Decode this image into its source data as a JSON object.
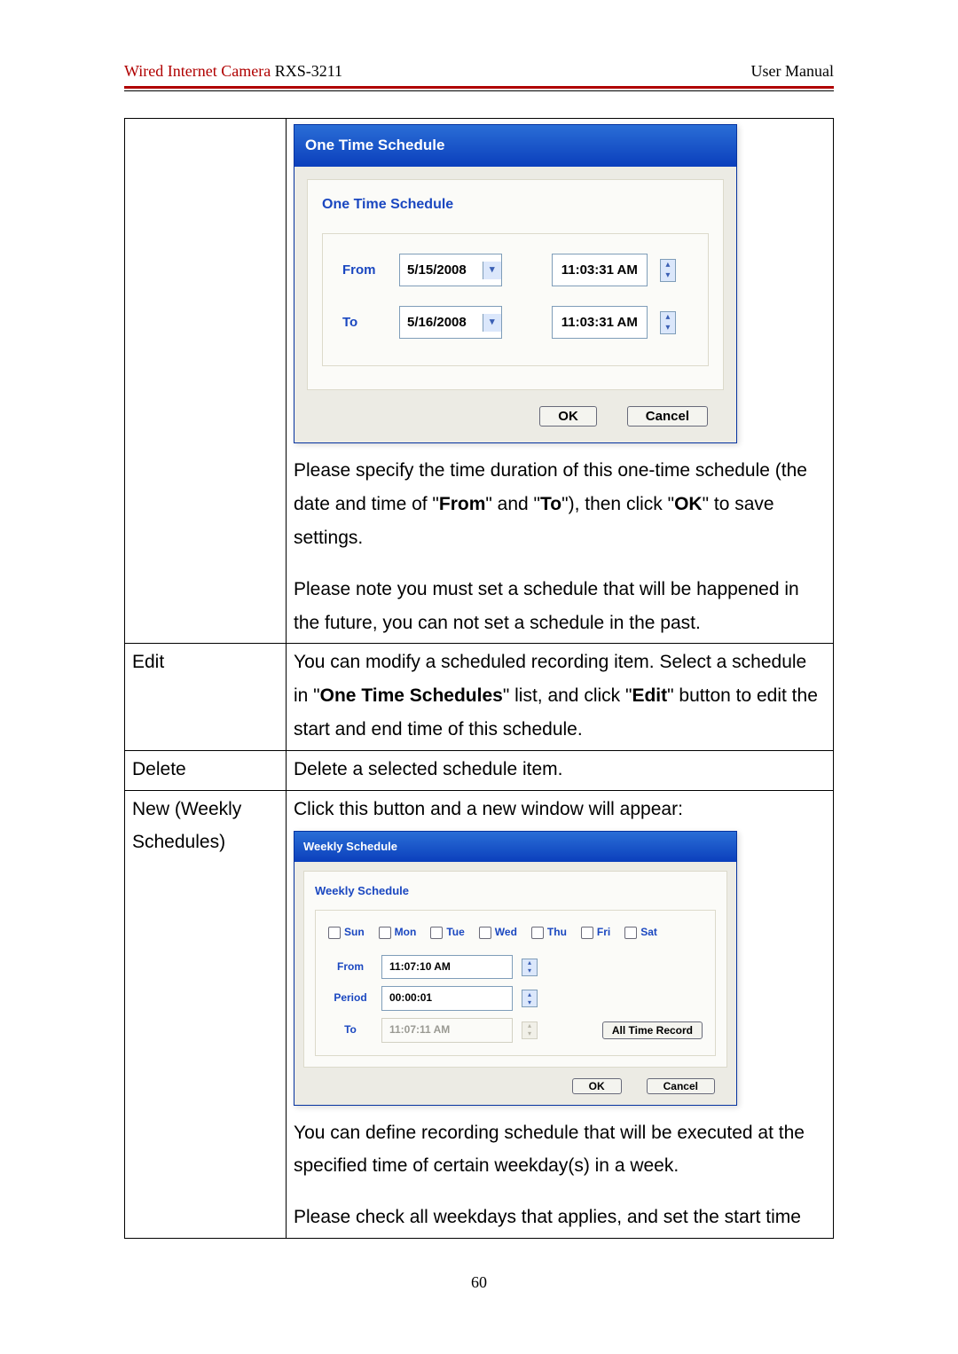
{
  "header": {
    "product_name": "Wired Internet Camera",
    "model": " RXS-3211",
    "right": "User Manual"
  },
  "ots": {
    "title": "One Time Schedule",
    "group_title": "One Time Schedule",
    "from_label": "From",
    "to_label": "To",
    "from_date": "5/15/2008",
    "to_date": "5/16/2008",
    "from_time": "11:03:31 AM",
    "to_time": "11:03:31 AM",
    "ok": "OK",
    "cancel": "Cancel"
  },
  "ots_desc1_a": "Please specify the time duration of this one-time schedule (the date and time of \"",
  "ots_desc1_b": "From",
  "ots_desc1_c": "\" and \"",
  "ots_desc1_d": "To",
  "ots_desc1_e": "\"), then click \"",
  "ots_desc1_f": "OK",
  "ots_desc1_g": "\" to save settings.",
  "ots_desc2": "Please note you must set a schedule that will be happened in the future, you can not set a schedule in the past.",
  "rows": {
    "edit_label": "Edit",
    "edit_a": "You can modify a scheduled recording item. Select a schedule in \"",
    "edit_b": "One Time Schedules",
    "edit_c": "\" list, and click \"",
    "edit_d": "Edit",
    "edit_e": "\" button to edit the start and end time of this schedule.",
    "delete_label": "Delete",
    "delete_text": "Delete a selected schedule item.",
    "new_label_1": "New (Weekly",
    "new_label_2": "Schedules)",
    "new_intro": "Click this button and a new window will appear:"
  },
  "wk": {
    "title": "Weekly Schedule",
    "group_title": "Weekly Schedule",
    "days": [
      "Sun",
      "Mon",
      "Tue",
      "Wed",
      "Thu",
      "Fri",
      "Sat"
    ],
    "from_label": "From",
    "period_label": "Period",
    "to_label": "To",
    "from_time": "11:07:10 AM",
    "period": "00:00:01",
    "to_time": "11:07:11 AM",
    "alltime": "All Time Record",
    "ok": "OK",
    "cancel": "Cancel"
  },
  "wk_desc1": "You can define recording schedule that will be executed at the specified time of certain weekday(s) in a week.",
  "wk_desc2": "Please check all weekdays that applies, and set the start time",
  "page_number": "60"
}
